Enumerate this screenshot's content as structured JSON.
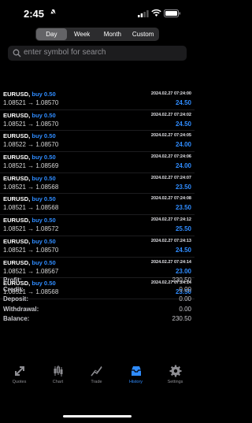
{
  "status": {
    "time": "2:45"
  },
  "periods": [
    "Day",
    "Week",
    "Month",
    "Custom"
  ],
  "active_period": "Day",
  "search": {
    "placeholder": "enter symbol for search"
  },
  "deals": [
    {
      "symbol": "EURUSD,",
      "side": "buy 0.50",
      "price": "1.08521 → 1.08570",
      "date": "2024.02.27 07:24:00",
      "profit": "24.50"
    },
    {
      "symbol": "EURUSD,",
      "side": "buy 0.50",
      "price": "1.08521 → 1.08570",
      "date": "2024.02.27 07:24:02",
      "profit": "24.50"
    },
    {
      "symbol": "EURUSD,",
      "side": "buy 0.50",
      "price": "1.08522 → 1.08570",
      "date": "2024.02.27 07:24:05",
      "profit": "24.00"
    },
    {
      "symbol": "EURUSD,",
      "side": "buy 0.50",
      "price": "1.08521 → 1.08569",
      "date": "2024.02.27 07:24:06",
      "profit": "24.00"
    },
    {
      "symbol": "EURUSD,",
      "side": "buy 0.50",
      "price": "1.08521 → 1.08568",
      "date": "2024.02.27 07:24:07",
      "profit": "23.50"
    },
    {
      "symbol": "EURUSD,",
      "side": "buy 0.50",
      "price": "1.08521 → 1.08568",
      "date": "2024.02.27 07:24:08",
      "profit": "23.50"
    },
    {
      "symbol": "EURUSD,",
      "side": "buy 0.50",
      "price": "1.08521 → 1.08572",
      "date": "2024.02.27 07:24:12",
      "profit": "25.50"
    },
    {
      "symbol": "EURUSD,",
      "side": "buy 0.50",
      "price": "1.08521 → 1.08570",
      "date": "2024.02.27 07:24:13",
      "profit": "24.50"
    },
    {
      "symbol": "EURUSD,",
      "side": "buy 0.50",
      "price": "1.08521 → 1.08567",
      "date": "2024.02.27 07:24:14",
      "profit": "23.00"
    },
    {
      "symbol": "EURUSD,",
      "side": "buy 0.50",
      "price": "1.08521 → 1.08568",
      "date": "2024.02.27 07:24:14",
      "profit": "23.50"
    }
  ],
  "summary": [
    {
      "label": "Profit:",
      "value": "230.50"
    },
    {
      "label": "Credit:",
      "value": "0.00"
    },
    {
      "label": "Deposit:",
      "value": "0.00"
    },
    {
      "label": "Withdrawal:",
      "value": "0.00"
    },
    {
      "label": "Balance:",
      "value": "230.50"
    }
  ],
  "tabbar": [
    {
      "label": "Quotes",
      "icon": "quotes-icon"
    },
    {
      "label": "Chart",
      "icon": "chart-icon"
    },
    {
      "label": "Trade",
      "icon": "trade-icon"
    },
    {
      "label": "History",
      "icon": "history-icon"
    },
    {
      "label": "Settings",
      "icon": "settings-icon"
    }
  ],
  "active_tab": "History",
  "colors": {
    "accent": "#2f8cff",
    "background": "#000000",
    "control": "#2c2c2e"
  }
}
